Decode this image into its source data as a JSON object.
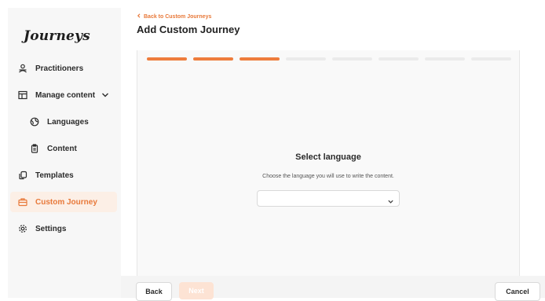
{
  "brand": {
    "logo_text": "Journeys",
    "accent_color": "#ee7c3c"
  },
  "sidebar": {
    "items": [
      {
        "label": "Practitioners",
        "icon": "users-icon"
      },
      {
        "label": "Manage content",
        "icon": "layout-icon",
        "expanded": true
      },
      {
        "label": "Languages",
        "icon": "globe-icon"
      },
      {
        "label": "Content",
        "icon": "clipboard-icon"
      },
      {
        "label": "Templates",
        "icon": "copy-icon"
      },
      {
        "label": "Custom Journey",
        "icon": "briefcase-icon",
        "active": true
      },
      {
        "label": "Settings",
        "icon": "gear-icon"
      }
    ]
  },
  "header": {
    "back_link": "Back to Custom Journeys",
    "title": "Add Custom Journey"
  },
  "progress": {
    "total_steps": 8,
    "completed_steps": 3
  },
  "step": {
    "title": "Select language",
    "subtitle": "Choose the language you will use to write the content.",
    "dropdown_value": ""
  },
  "footer": {
    "back_label": "Back",
    "next_label": "Next",
    "cancel_label": "Cancel"
  }
}
